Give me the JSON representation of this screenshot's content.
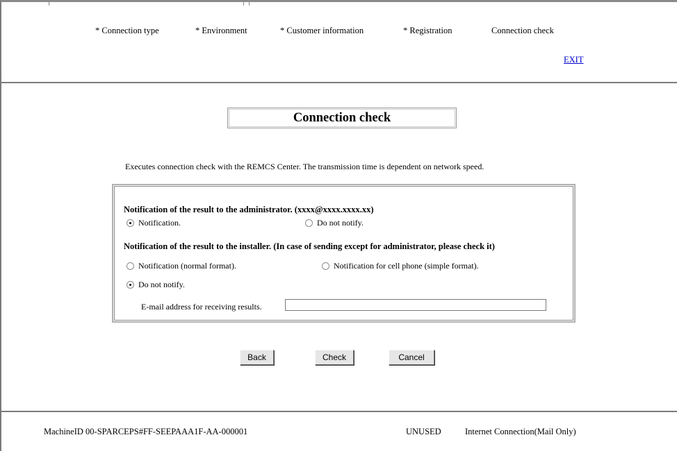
{
  "steps": [
    "* Connection type",
    "* Environment",
    "* Customer information",
    "* Registration",
    "Connection check"
  ],
  "exit_label": "EXIT",
  "title": "Connection check",
  "description": "Executes connection check with the REMCS Center. The transmission time is dependent on network speed.",
  "admin": {
    "label": "Notification of the result to the administrator. (xxxx@xxxx.xxxx.xx)",
    "options": [
      "Notification.",
      "Do not notify."
    ],
    "selected": 0
  },
  "installer": {
    "label": "Notification of the result to the installer. (In case of sending except for administrator, please check it)",
    "options": [
      "Notification (normal format).",
      "Notification for cell phone (simple format).",
      "Do not notify."
    ],
    "selected": 2
  },
  "email": {
    "label": "E-mail address for receiving results.",
    "value": ""
  },
  "buttons": {
    "back": "Back",
    "check": "Check",
    "cancel": "Cancel"
  },
  "status": {
    "machine_id": "MachineID 00-SPARCEPS#FF-SEEPAAA1F-AA-000001",
    "state": "UNUSED",
    "connection": "Internet Connection(Mail Only)"
  }
}
